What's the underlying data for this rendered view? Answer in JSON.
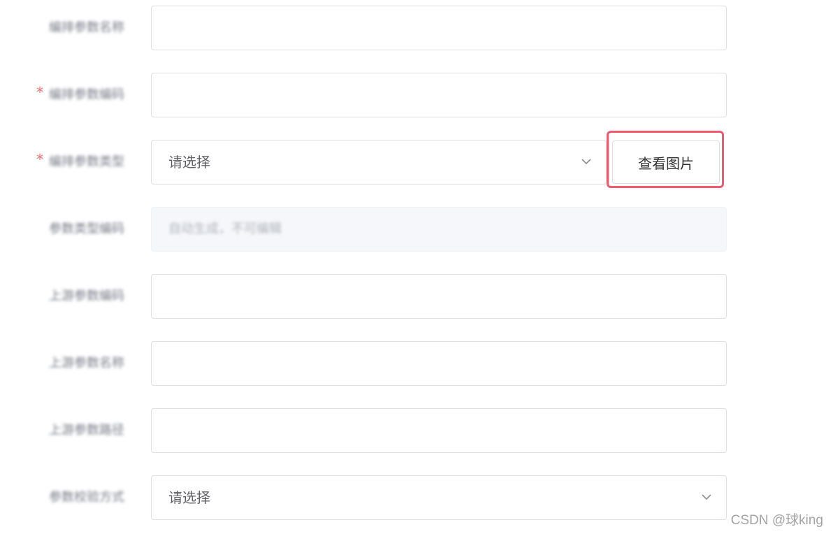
{
  "form": {
    "rows": [
      {
        "label": "编排参数名称",
        "required": false,
        "type": "input",
        "value": ""
      },
      {
        "label": "编排参数编码",
        "required": true,
        "type": "input",
        "value": ""
      },
      {
        "label": "编排参数类型",
        "required": true,
        "type": "select",
        "value": "请选择"
      },
      {
        "label": "参数类型编码",
        "required": false,
        "type": "disabled",
        "value": "自动生成，不可编辑"
      },
      {
        "label": "上游参数编码",
        "required": false,
        "type": "input",
        "value": ""
      },
      {
        "label": "上游参数名称",
        "required": false,
        "type": "input",
        "value": ""
      },
      {
        "label": "上游参数路径",
        "required": false,
        "type": "input",
        "value": ""
      },
      {
        "label": "参数校验方式",
        "required": false,
        "type": "select",
        "value": "请选择"
      }
    ],
    "view_image_button": "查看图片",
    "required_mark": "*"
  },
  "icons": {
    "select_arrow": "chevron-down-icon"
  },
  "colors": {
    "highlight": "#ef5a6c",
    "required": "#f56c6c",
    "disabled_bg": "#f5f7fa"
  },
  "watermark": "CSDN @球king"
}
